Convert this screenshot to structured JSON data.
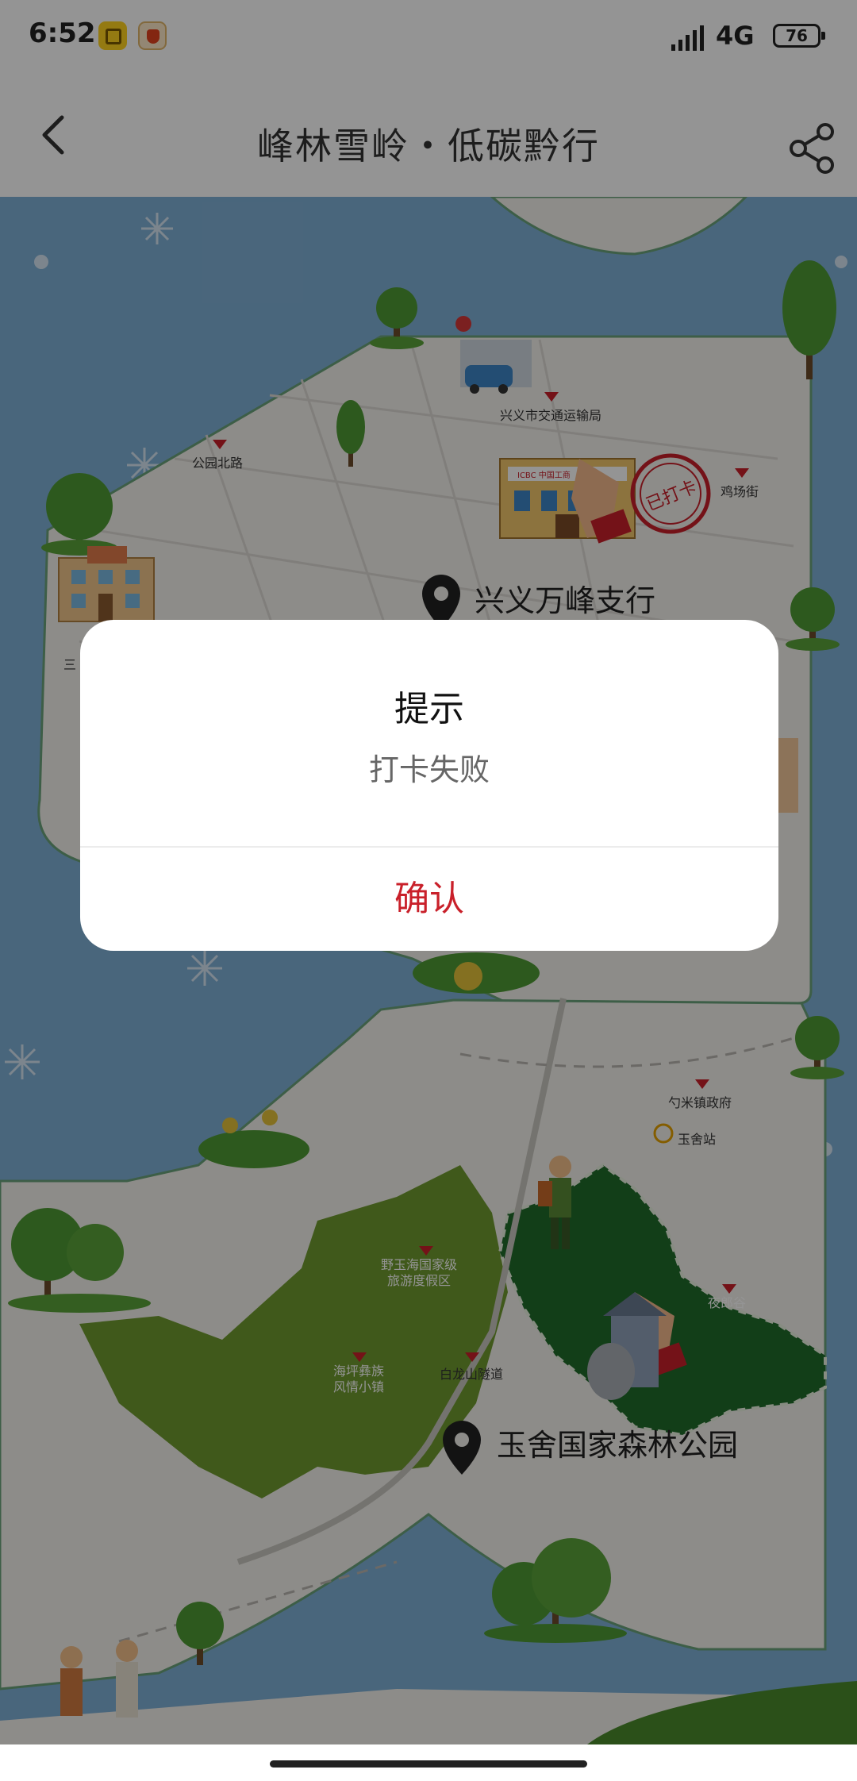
{
  "status_bar": {
    "time": "6:52",
    "network": "4G",
    "battery": "76"
  },
  "header": {
    "title": "峰林雪岭・低碳黔行",
    "back_icon": "chevron-left-icon",
    "share_icon": "share-icon"
  },
  "map": {
    "labels": {
      "gongyuan_beilu": "公园北路",
      "jiaotong_ju": "兴义市交通运输局",
      "jichang_jie": "鸡场街",
      "san": "三",
      "shaomi_zhen": "勺米镇政府",
      "yushe_zhan": "玉舍站",
      "yeshe_haiyuan": "野玉海国家级\n旅游度假区",
      "yelang_gu": "夜郎谷",
      "haiping": "海坪彝族\n风情小镇",
      "bailongshan": "白龙山隧道"
    },
    "pins": {
      "bank_branch": "兴义万峰支行",
      "forest_park": "玉舍国家森林公园"
    },
    "stamp_text": "已打卡",
    "icbc_sign": "ICBC 中国工商"
  },
  "dialog": {
    "title": "提示",
    "message": "打卡失败",
    "confirm_label": "确认"
  },
  "colors": {
    "water": "#7fb0d6",
    "land": "#f3f1ec",
    "park_green": "#6e9a2f",
    "dark_green": "#1f6b2a",
    "accent_red": "#c9202a",
    "overlay": "rgba(0,0,0,0.42)"
  }
}
